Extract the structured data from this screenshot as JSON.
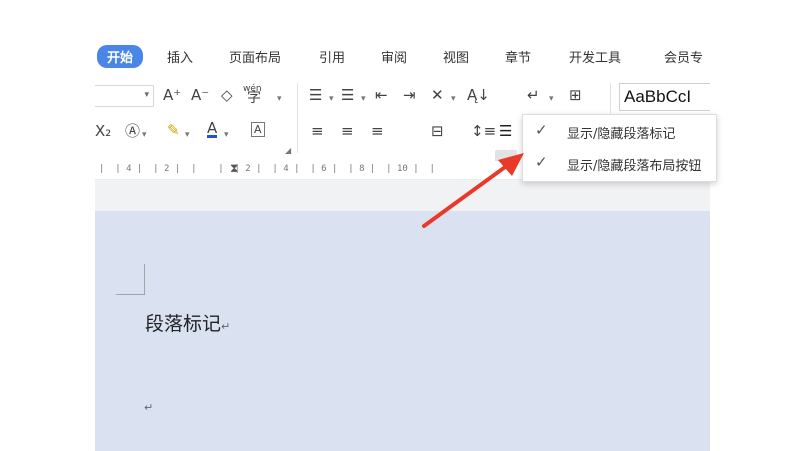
{
  "tabs": [
    {
      "label": "开始",
      "active": true
    },
    {
      "label": "插入"
    },
    {
      "label": "页面布局"
    },
    {
      "label": "引用"
    },
    {
      "label": "审阅"
    },
    {
      "label": "视图"
    },
    {
      "label": "章节"
    },
    {
      "label": "开发工具"
    },
    {
      "label": "会员专"
    }
  ],
  "toolbar": {
    "style_preview": "AaBbCcI",
    "phonetic_label": "wén",
    "phonetic_char": "字",
    "subscript": "X₂"
  },
  "ruler": {
    "ticks": "|  | 4 |  | 2 |  |    |  | 2 |  | 4 |  | 6 |  | 8 |  | 10 |  |"
  },
  "dropdown": {
    "items": [
      {
        "label": "显示/隐藏段落标记",
        "checked": true
      },
      {
        "label": "显示/隐藏段落布局按钮",
        "checked": true
      }
    ]
  },
  "document": {
    "paragraph_text": "段落标记",
    "return_mark": "↵"
  },
  "colors": {
    "tab_active": "#4a86e8",
    "doc_background": "#dae2f2",
    "arrow": "#e8392a"
  }
}
